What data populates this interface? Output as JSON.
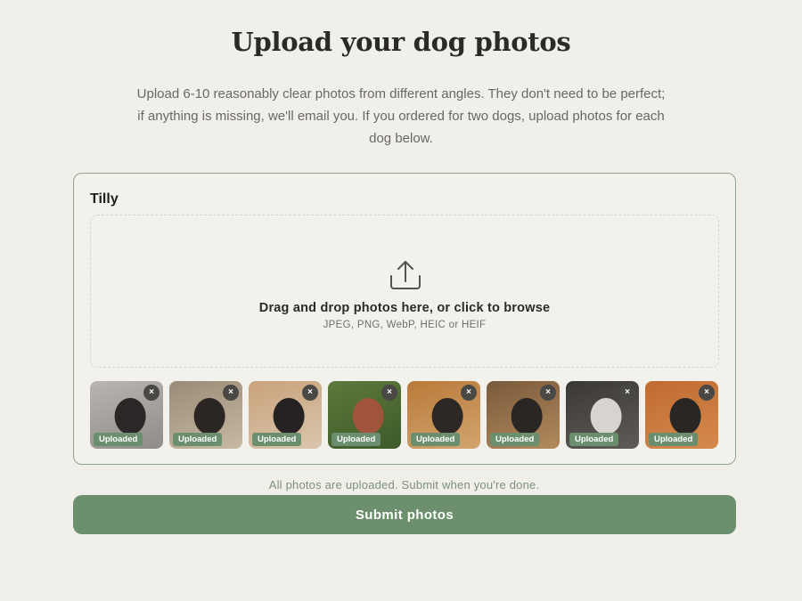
{
  "header": {
    "title": "Upload your dog photos",
    "intro": "Upload 6-10 reasonably clear photos from different angles. They don't need to be perfect; if anything is missing, we'll email you. If you ordered for two dogs, upload photos for each dog below."
  },
  "dog": {
    "name": "Tilly",
    "dropzone": {
      "icon": "upload-icon",
      "title": "Drag and drop photos here, or click to browse",
      "formats": "JPEG, PNG, WebP, HEIC or HEIF"
    },
    "photos": [
      {
        "status": "Uploaded",
        "remove": "×",
        "scene": "dog on grey couch",
        "colors": [
          "#b9b6b1",
          "#2a2726",
          "#8f8c88"
        ]
      },
      {
        "status": "Uploaded",
        "remove": "×",
        "scene": "dog on sofa",
        "colors": [
          "#9a8b78",
          "#2b2624",
          "#c8b9a2"
        ]
      },
      {
        "status": "Uploaded",
        "remove": "×",
        "scene": "dog close-up",
        "colors": [
          "#c9a27a",
          "#252221",
          "#d9c6ae"
        ]
      },
      {
        "status": "Uploaded",
        "remove": "×",
        "scene": "dog in garden",
        "colors": [
          "#5c7a3a",
          "#a1543c",
          "#3d5a2a"
        ]
      },
      {
        "status": "Uploaded",
        "remove": "×",
        "scene": "dog by wooden cabinets",
        "colors": [
          "#b97a38",
          "#2d2825",
          "#d2a570"
        ]
      },
      {
        "status": "Uploaded",
        "remove": "×",
        "scene": "dog on dog bed",
        "colors": [
          "#7a5a3c",
          "#2a2624",
          "#b28a5c"
        ]
      },
      {
        "status": "Uploaded",
        "remove": "×",
        "scene": "dog in living room",
        "colors": [
          "#3a3835",
          "#d7d4cf",
          "#5f5c58"
        ]
      },
      {
        "status": "Uploaded",
        "remove": "×",
        "scene": "dog in kitchen",
        "colors": [
          "#c06a32",
          "#2a2624",
          "#d68a4c"
        ]
      }
    ]
  },
  "footer": {
    "status_text": "All photos are uploaded. Submit when you're done.",
    "submit_label": "Submit photos"
  },
  "colors": {
    "accent": "#6c8f6e",
    "card_border": "#8fa58d",
    "background": "#f1efea",
    "status_text": "#7d9079"
  }
}
